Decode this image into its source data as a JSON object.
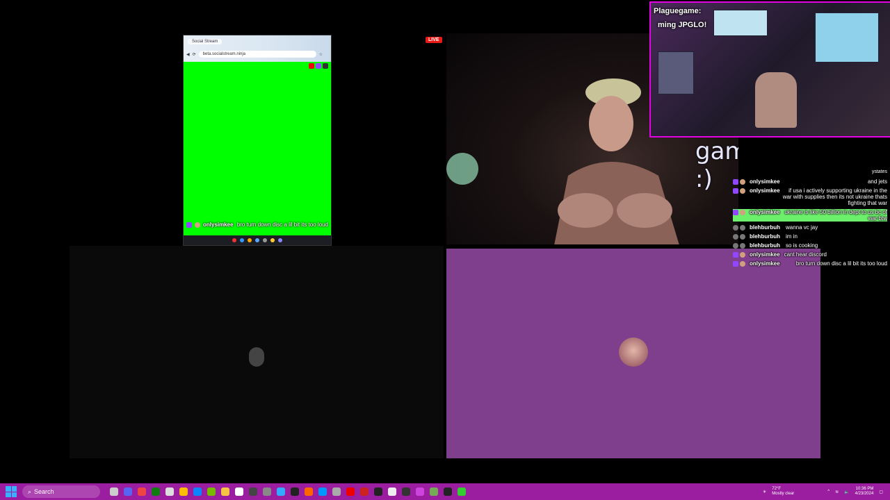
{
  "browser": {
    "tab_label": "Social Stream",
    "address": "beta.socialstream.ninja",
    "chat_user": "onlysimkee",
    "chat_message": "bro turn down disc a lil bit its too loud"
  },
  "live_badge": "LIVE",
  "webcam": {
    "overlay_text": "game :)"
  },
  "facecam": {
    "title": "Plaguegame:",
    "subtitle": "ming JPGLO!"
  },
  "chat": {
    "top_fragment": "ystates",
    "messages": [
      {
        "user": "onlysimkee",
        "text": "and jets",
        "badges": [
          "twitch",
          "avatar"
        ],
        "highlight": false
      },
      {
        "user": "onlysimkee",
        "text": "if usa i actively supporting ukraine in the war with supplies then its not ukraine thats fighting that war",
        "badges": [
          "twitch",
          "avatar"
        ],
        "highlight": false
      },
      {
        "user": "onlysimkee",
        "text": "ukraine is like 50 billion in dept to us bc of war btw",
        "badges": [
          "twitch",
          "avatar"
        ],
        "highlight": true
      },
      {
        "user": "blehburbuh",
        "text": "wanna vc jay",
        "badges": [
          "discord",
          "generic"
        ],
        "highlight": false
      },
      {
        "user": "blehburbuh",
        "text": "im in",
        "badges": [
          "discord",
          "generic"
        ],
        "highlight": false
      },
      {
        "user": "blehburbuh",
        "text": "so is cooking",
        "badges": [
          "discord",
          "generic"
        ],
        "highlight": false
      },
      {
        "user": "onlysimkee",
        "text": "cant hear discord",
        "badges": [
          "twitch",
          "avatar"
        ],
        "highlight": false
      },
      {
        "user": "onlysimkee",
        "text": "bro turn down disc a lil bit its too loud",
        "badges": [
          "twitch",
          "avatar"
        ],
        "highlight": false
      }
    ]
  },
  "taskbar": {
    "search_label": "Search",
    "weather_temp": "72°F",
    "weather_desc": "Mostly clear",
    "time": "10:36 PM",
    "date": "4/23/2024"
  },
  "colors": {
    "green_screen": "#00ff00",
    "discord_purple": "#7f3f8c",
    "facecam_border": "#e600e6",
    "taskbar": "#9b1ea0",
    "twitch": "#9146ff"
  }
}
